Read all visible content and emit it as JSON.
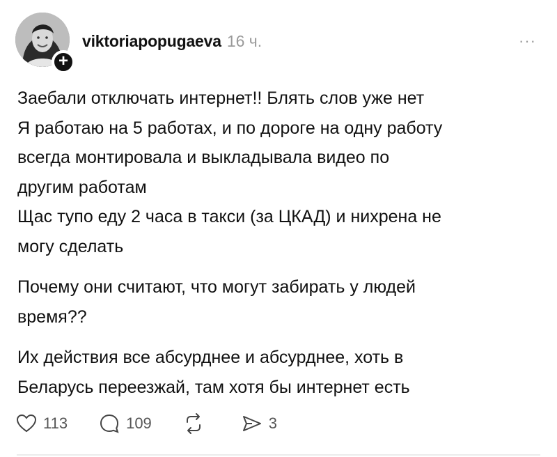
{
  "post": {
    "username": "viktoriapopugaeva",
    "time": "16 ч.",
    "more_icon": "more-icon",
    "follow_symbol": "+",
    "paragraphs": [
      "Заебали отключать интернет!! Блять слов уже нет\nЯ работаю на 5 работах, и по дороге на одну работу\nвсегда монтировала и выкладывала видео по\nдругим работам\nЩас тупо еду 2 часа в такси (за ЦКАД) и нихрена не\nмогу сделать",
      "Почему они считают, что могут забирать у людей\nвремя??",
      "Их действия все абсурднее и абсурднее, хоть в\nБеларусь переезжай, там хотя бы интернет есть"
    ]
  },
  "actions": {
    "likes": "113",
    "comments": "109",
    "shares": "3"
  }
}
